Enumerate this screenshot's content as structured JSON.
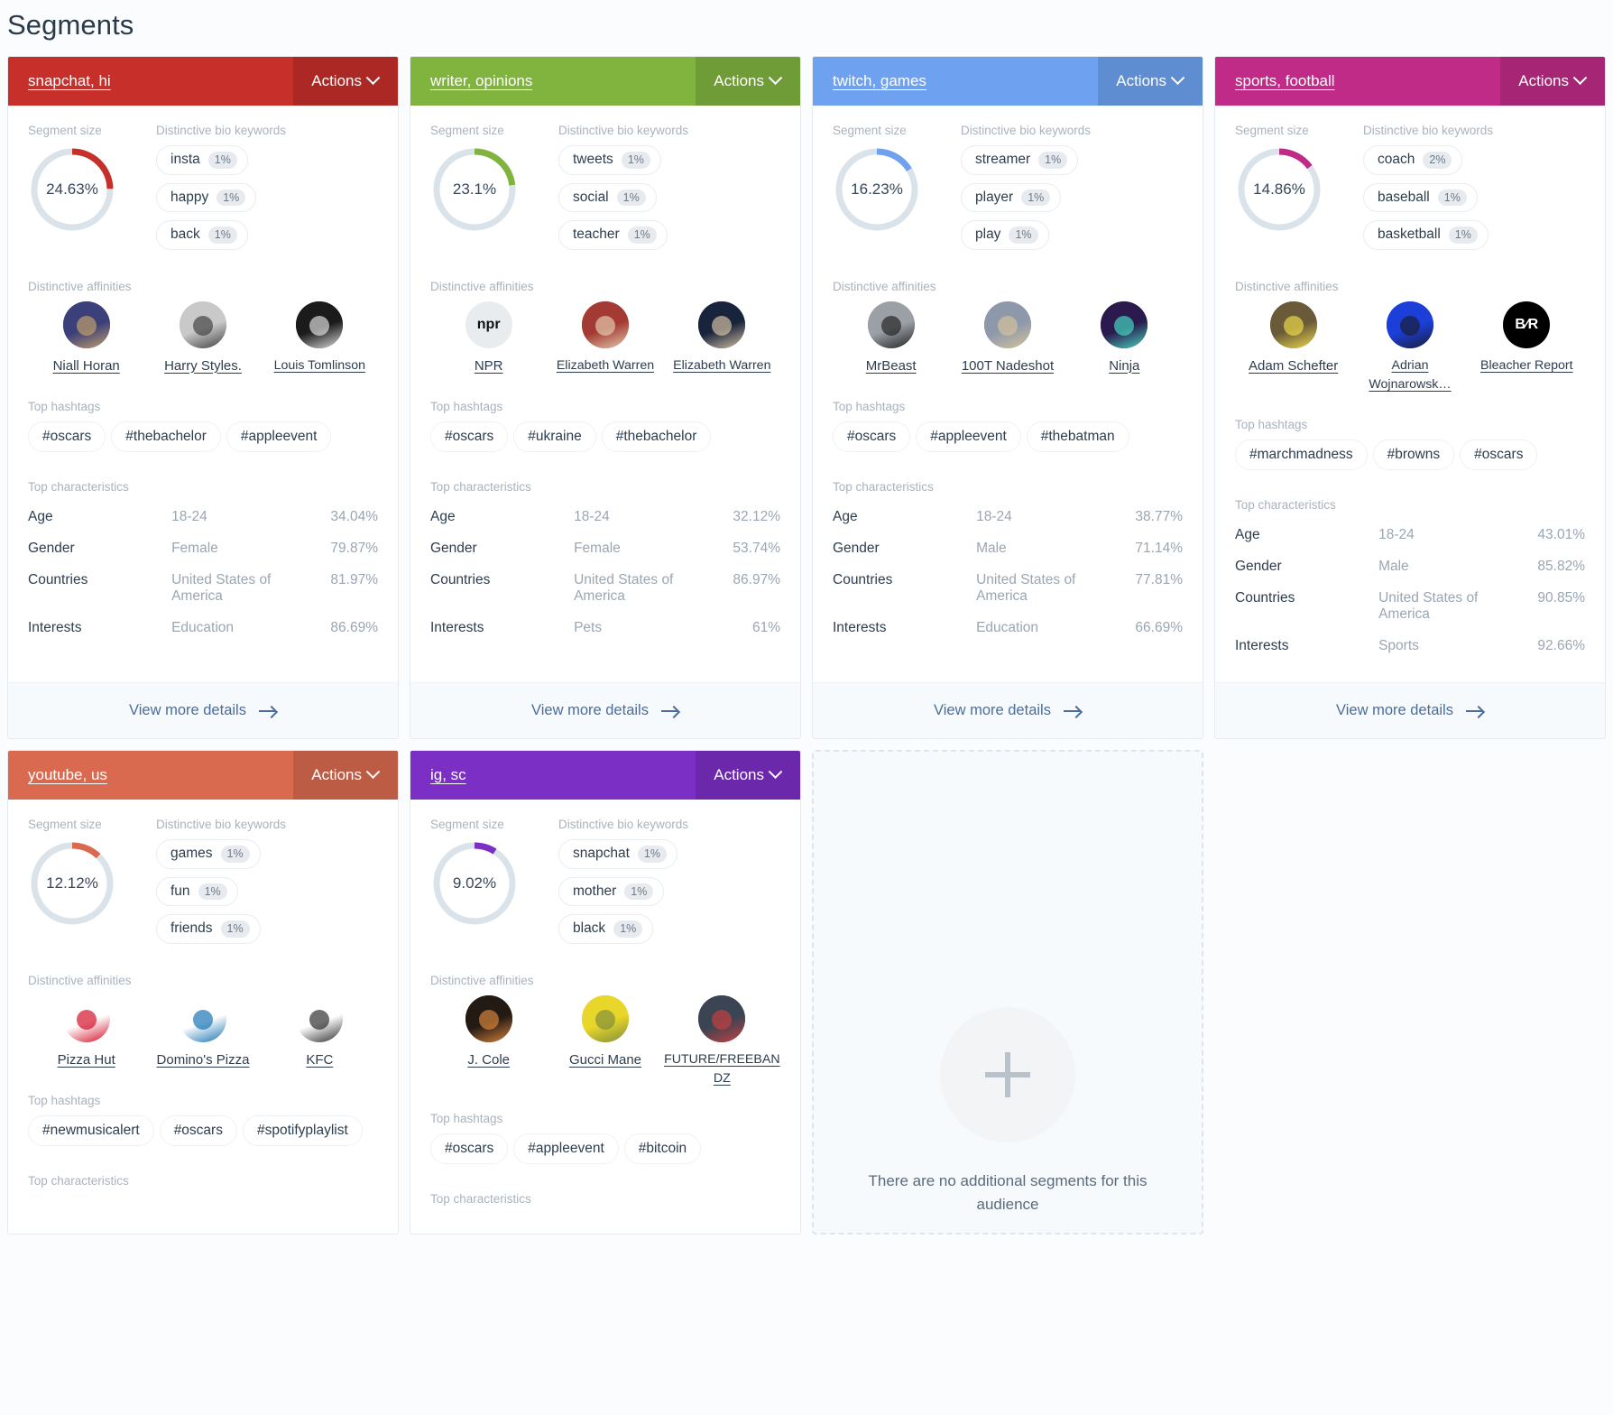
{
  "page": {
    "title": "Segments"
  },
  "labels": {
    "segment_size": "Segment size",
    "bio_keywords": "Distinctive bio keywords",
    "affinities": "Distinctive affinities",
    "hashtags": "Top hashtags",
    "characteristics": "Top characteristics",
    "actions": "Actions",
    "view_more": "View more details"
  },
  "empty_card": {
    "text": "There are no additional segments for this audience"
  },
  "chart_data": {
    "type": "pie",
    "title": "Segment size",
    "categories": [
      "snapchat, hi",
      "writer, opinions",
      "twitch, games",
      "sports, football",
      "youtube, us",
      "ig, sc"
    ],
    "values": [
      24.63,
      23.1,
      16.23,
      14.86,
      12.12,
      9.02
    ],
    "unit": "%",
    "ylim": [
      0,
      100
    ],
    "note": "Each card shows a donut gauge of that segment's share of the audience"
  },
  "segments": [
    {
      "name": "snapchat, hi",
      "color": "#c62f2a",
      "size": "24.63%",
      "size_value": 24.63,
      "keywords": [
        {
          "word": "insta",
          "pct": "1%"
        },
        {
          "word": "happy",
          "pct": "1%"
        },
        {
          "word": "back",
          "pct": "1%"
        }
      ],
      "affinities": [
        {
          "name": "Niall Horan",
          "avatar_bg": "#3b3f7a",
          "avatar_fg": "#c9a46a",
          "glyph": ""
        },
        {
          "name": "Harry Styles.",
          "avatar_bg": "#c9c9c9",
          "avatar_fg": "#3a3a3a",
          "glyph": ""
        },
        {
          "name": "Louis Tomlinson",
          "avatar_bg": "#1b1b1b",
          "avatar_fg": "#e8e8e8",
          "glyph": ""
        }
      ],
      "hashtags": [
        "#oscars",
        "#thebachelor",
        "#appleevent"
      ],
      "characteristics": [
        {
          "key": "Age",
          "value": "18-24",
          "pct": "34.04%"
        },
        {
          "key": "Gender",
          "value": "Female",
          "pct": "79.87%"
        },
        {
          "key": "Countries",
          "value": "United States of America",
          "pct": "81.97%"
        },
        {
          "key": "Interests",
          "value": "Education",
          "pct": "86.69%"
        }
      ]
    },
    {
      "name": "writer, opinions",
      "color": "#80b43f",
      "size": "23.1%",
      "size_value": 23.1,
      "keywords": [
        {
          "word": "tweets",
          "pct": "1%"
        },
        {
          "word": "social",
          "pct": "1%"
        },
        {
          "word": "teacher",
          "pct": "1%"
        }
      ],
      "affinities": [
        {
          "name": "NPR",
          "avatar_bg": "#e9ecef",
          "avatar_fg": "#111111",
          "glyph": "npr"
        },
        {
          "name": "Elizabeth Warren",
          "avatar_bg": "#a33a33",
          "avatar_fg": "#e8d2b5",
          "glyph": ""
        },
        {
          "name": "Elizabeth Warren",
          "avatar_bg": "#18243c",
          "avatar_fg": "#dfc9a8",
          "glyph": ""
        }
      ],
      "hashtags": [
        "#oscars",
        "#ukraine",
        "#thebachelor"
      ],
      "characteristics": [
        {
          "key": "Age",
          "value": "18-24",
          "pct": "32.12%"
        },
        {
          "key": "Gender",
          "value": "Female",
          "pct": "53.74%"
        },
        {
          "key": "Countries",
          "value": "United States of America",
          "pct": "86.97%"
        },
        {
          "key": "Interests",
          "value": "Pets",
          "pct": "61%"
        }
      ]
    },
    {
      "name": "twitch, games",
      "color": "#6ea2f0",
      "size": "16.23%",
      "size_value": 16.23,
      "keywords": [
        {
          "word": "streamer",
          "pct": "1%"
        },
        {
          "word": "player",
          "pct": "1%"
        },
        {
          "word": "play",
          "pct": "1%"
        }
      ],
      "affinities": [
        {
          "name": "MrBeast",
          "avatar_bg": "#9aa0a6",
          "avatar_fg": "#1c1c1c",
          "glyph": ""
        },
        {
          "name": "100T Nadeshot",
          "avatar_bg": "#8d99ab",
          "avatar_fg": "#d8c49b",
          "glyph": ""
        },
        {
          "name": "Ninja",
          "avatar_bg": "#2a1a4d",
          "avatar_fg": "#47e0c8",
          "glyph": ""
        }
      ],
      "hashtags": [
        "#oscars",
        "#appleevent",
        "#thebatman"
      ],
      "characteristics": [
        {
          "key": "Age",
          "value": "18-24",
          "pct": "38.77%"
        },
        {
          "key": "Gender",
          "value": "Male",
          "pct": "71.14%"
        },
        {
          "key": "Countries",
          "value": "United States of America",
          "pct": "77.81%"
        },
        {
          "key": "Interests",
          "value": "Education",
          "pct": "66.69%"
        }
      ]
    },
    {
      "name": "sports, football",
      "color": "#bf2b87",
      "size": "14.86%",
      "size_value": 14.86,
      "keywords": [
        {
          "word": "coach",
          "pct": "2%"
        },
        {
          "word": "baseball",
          "pct": "1%"
        },
        {
          "word": "basketball",
          "pct": "1%"
        }
      ],
      "affinities": [
        {
          "name": "Adam Schefter",
          "avatar_bg": "#6a5a3a",
          "avatar_fg": "#f4e04a",
          "glyph": ""
        },
        {
          "name": "Adrian Wojnarowsk…",
          "avatar_bg": "#1b3fd8",
          "avatar_fg": "#1b1b2b",
          "glyph": ""
        },
        {
          "name": "Bleacher Report",
          "avatar_bg": "#000000",
          "avatar_fg": "#ffffff",
          "glyph": "B⁄R"
        }
      ],
      "hashtags": [
        "#marchmadness",
        "#browns",
        "#oscars"
      ],
      "characteristics": [
        {
          "key": "Age",
          "value": "18-24",
          "pct": "43.01%"
        },
        {
          "key": "Gender",
          "value": "Male",
          "pct": "85.82%"
        },
        {
          "key": "Countries",
          "value": "United States of America",
          "pct": "90.85%"
        },
        {
          "key": "Interests",
          "value": "Sports",
          "pct": "92.66%"
        }
      ]
    },
    {
      "name": "youtube, us",
      "color": "#d96a50",
      "size": "12.12%",
      "size_value": 12.12,
      "keywords": [
        {
          "word": "games",
          "pct": "1%"
        },
        {
          "word": "fun",
          "pct": "1%"
        },
        {
          "word": "friends",
          "pct": "1%"
        }
      ],
      "affinities": [
        {
          "name": "Pizza Hut",
          "avatar_bg": "#ffffff",
          "avatar_fg": "#d0021b",
          "glyph": ""
        },
        {
          "name": "Domino's Pizza",
          "avatar_bg": "#ffffff",
          "avatar_fg": "#0b6cb0",
          "glyph": ""
        },
        {
          "name": "KFC",
          "avatar_bg": "#ffffff",
          "avatar_fg": "#222222",
          "glyph": ""
        }
      ],
      "hashtags": [
        "#newmusicalert",
        "#oscars",
        "#spotifyplaylist"
      ],
      "characteristics": []
    },
    {
      "name": "ig, sc",
      "color": "#7b2fc4",
      "size": "9.02%",
      "size_value": 9.02,
      "keywords": [
        {
          "word": "snapchat",
          "pct": "1%"
        },
        {
          "word": "mother",
          "pct": "1%"
        },
        {
          "word": "black",
          "pct": "1%"
        }
      ],
      "affinities": [
        {
          "name": "J. Cole",
          "avatar_bg": "#241a14",
          "avatar_fg": "#e08a3c",
          "glyph": ""
        },
        {
          "name": "Gucci Mane",
          "avatar_bg": "#e8d62a",
          "avatar_fg": "#7a8a3a",
          "glyph": ""
        },
        {
          "name": "FUTURE/FREEBANDZ",
          "avatar_bg": "#3a4452",
          "avatar_fg": "#cf4040",
          "glyph": ""
        }
      ],
      "hashtags": [
        "#oscars",
        "#appleevent",
        "#bitcoin"
      ],
      "characteristics": []
    }
  ]
}
